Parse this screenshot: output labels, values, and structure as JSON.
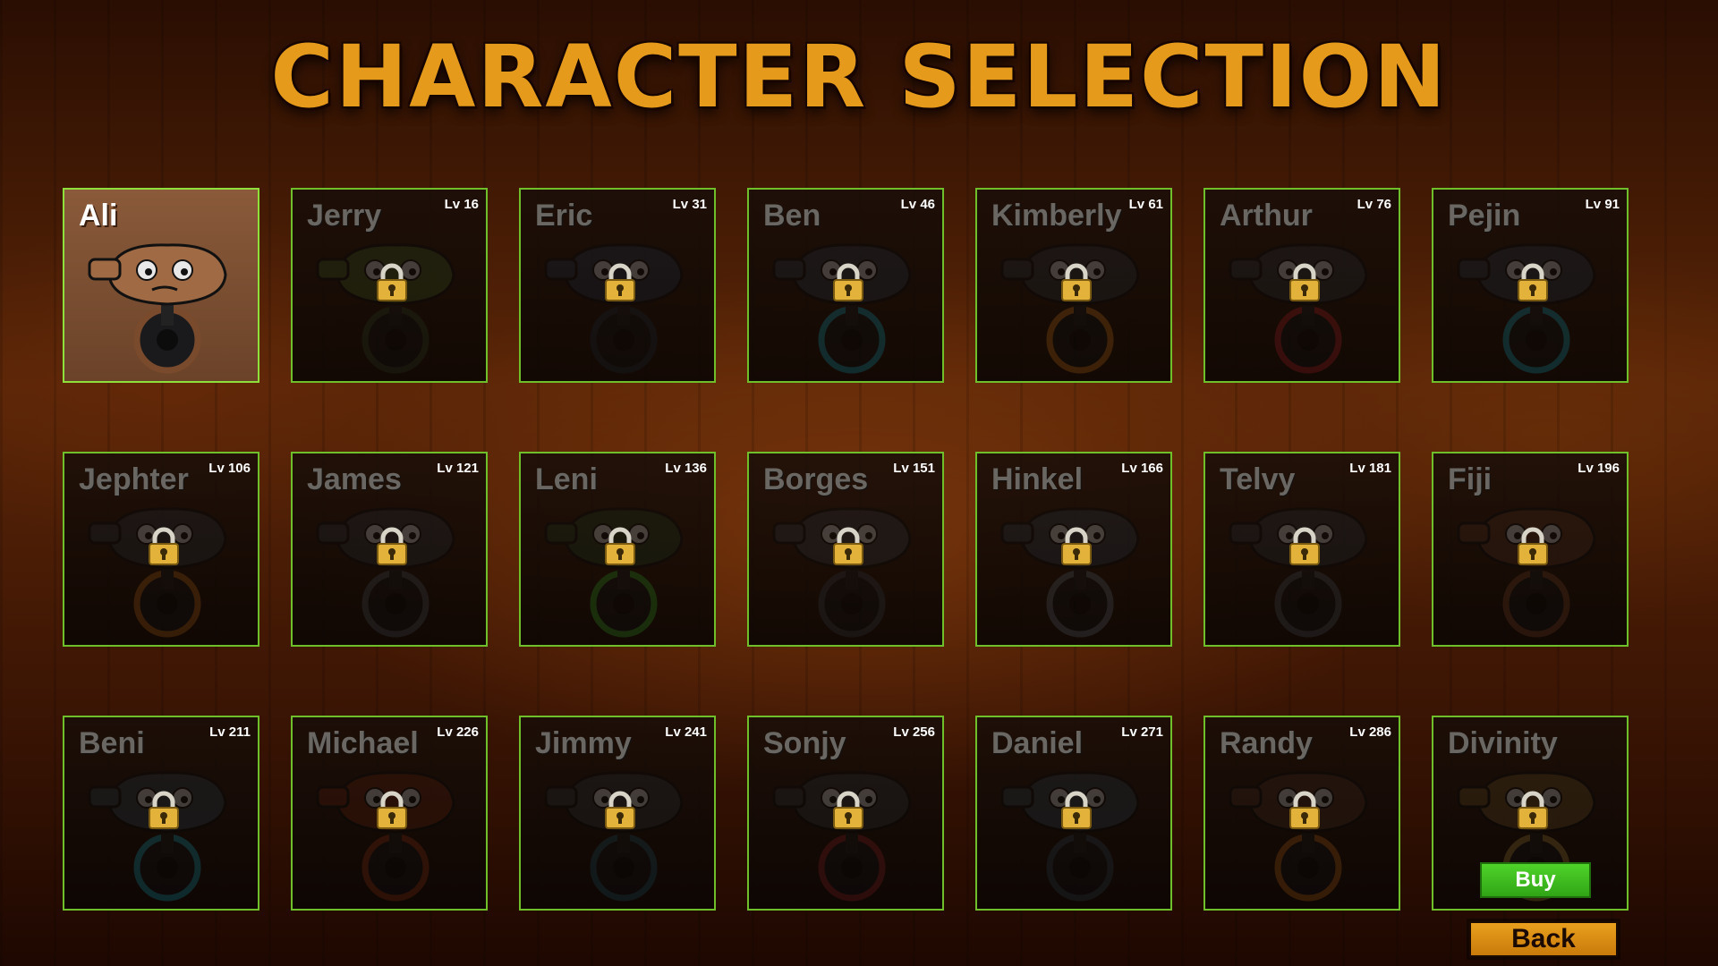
{
  "title": "CHARACTER SELECTION",
  "characters": [
    {
      "name": "Ali",
      "level": "",
      "locked": false,
      "color": "#a06a44",
      "wheel": "#7a4a2c"
    },
    {
      "name": "Jerry",
      "level": "Lv 16",
      "locked": true,
      "color": "#4d6a2a",
      "wheel": "#3a4a2a"
    },
    {
      "name": "Eric",
      "level": "Lv 31",
      "locked": true,
      "color": "#2f3a52",
      "wheel": "#2a3344"
    },
    {
      "name": "Ben",
      "level": "Lv 46",
      "locked": true,
      "color": "#3a4450",
      "wheel": "#1fa3b8"
    },
    {
      "name": "Kimberly",
      "level": "Lv 61",
      "locked": true,
      "color": "#3a3d44",
      "wheel": "#d2781c"
    },
    {
      "name": "Arthur",
      "level": "Lv 76",
      "locked": true,
      "color": "#3a3d44",
      "wheel": "#c0282a"
    },
    {
      "name": "Pejin",
      "level": "Lv 91",
      "locked": true,
      "color": "#3a4450",
      "wheel": "#1fa3b8"
    },
    {
      "name": "Jephter",
      "level": "Lv 106",
      "locked": true,
      "color": "#3a3d44",
      "wheel": "#c26a1a"
    },
    {
      "name": "James",
      "level": "Lv 121",
      "locked": true,
      "color": "#3a3d44",
      "wheel": "#555a60"
    },
    {
      "name": "Leni",
      "level": "Lv 136",
      "locked": true,
      "color": "#2e4a26",
      "wheel": "#3fae2a"
    },
    {
      "name": "Borges",
      "level": "Lv 151",
      "locked": true,
      "color": "#44464a",
      "wheel": "#44464a"
    },
    {
      "name": "Hinkel",
      "level": "Lv 166",
      "locked": true,
      "color": "#3a4450",
      "wheel": "#6a7078"
    },
    {
      "name": "Telvy",
      "level": "Lv 181",
      "locked": true,
      "color": "#3a3d44",
      "wheel": "#555a60"
    },
    {
      "name": "Fiji",
      "level": "Lv 196",
      "locked": true,
      "color": "#6a3e28",
      "wheel": "#8a4a2a"
    },
    {
      "name": "Beni",
      "level": "Lv 211",
      "locked": true,
      "color": "#3a4a58",
      "wheel": "#1fa3b8"
    },
    {
      "name": "Michael",
      "level": "Lv 226",
      "locked": true,
      "color": "#7a2e14",
      "wheel": "#a03a18"
    },
    {
      "name": "Jimmy",
      "level": "Lv 241",
      "locked": true,
      "color": "#3a3d44",
      "wheel": "#2a5a6a"
    },
    {
      "name": "Sonjy",
      "level": "Lv 256",
      "locked": true,
      "color": "#3a3d44",
      "wheel": "#a02a2a"
    },
    {
      "name": "Daniel",
      "level": "Lv 271",
      "locked": true,
      "color": "#3a4a58",
      "wheel": "#3a4a58"
    },
    {
      "name": "Randy",
      "level": "Lv 286",
      "locked": true,
      "color": "#5a3a2a",
      "wheel": "#c26a1a"
    },
    {
      "name": "Divinity",
      "level": "",
      "locked": true,
      "color": "#7a5a2a",
      "wheel": "#b08a3a",
      "buy": "Buy"
    }
  ],
  "back_label": "Back",
  "icons": {
    "lock": "padlock-icon"
  }
}
